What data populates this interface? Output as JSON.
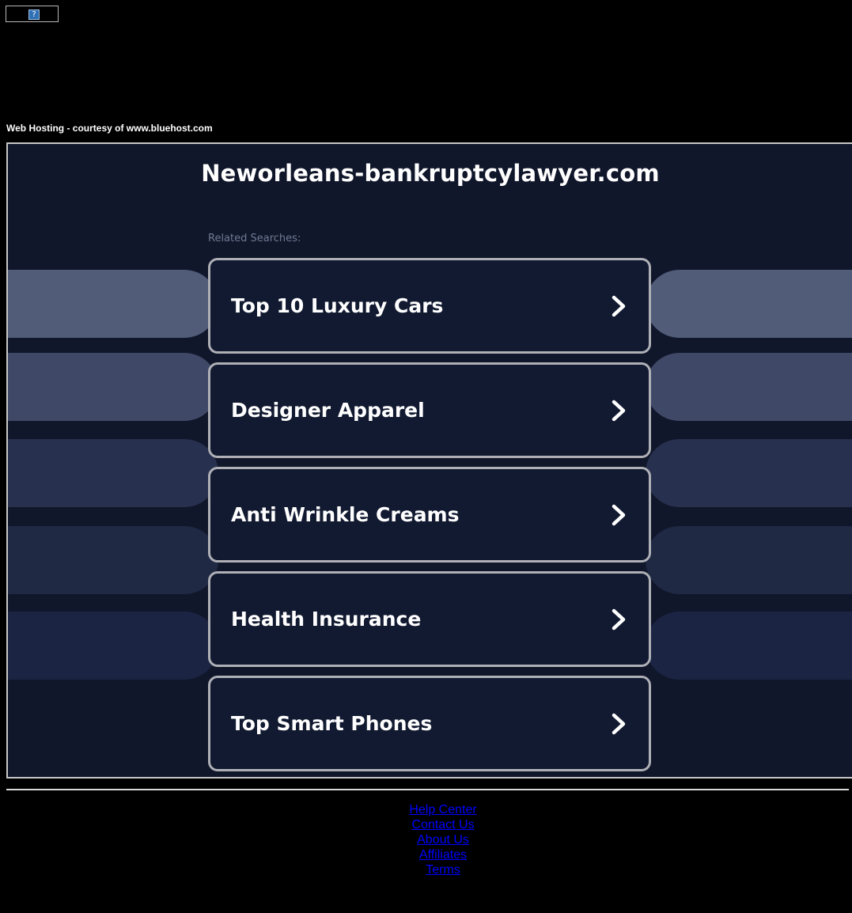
{
  "banner": {
    "broken_image_glyph": "?"
  },
  "hosting_note": "Web Hosting - courtesy of www.bluehost.com",
  "domain_title": "Neworleans-bankruptcylawyer.com",
  "related_label": "Related Searches:",
  "searches": [
    {
      "label": "Top 10 Luxury Cars"
    },
    {
      "label": "Designer Apparel"
    },
    {
      "label": "Anti Wrinkle Creams"
    },
    {
      "label": "Health Insurance"
    },
    {
      "label": "Top Smart Phones"
    }
  ],
  "side_pill_colors": [
    "#515c79",
    "#3f4967",
    "#27304e",
    "#1f2944",
    "#1b2443"
  ],
  "icons": {
    "card_arrow": "chevron-right-icon"
  },
  "footer": {
    "links": [
      "Help Center",
      "Contact Us",
      "About Us",
      "Affiliates",
      "Terms"
    ]
  },
  "colors": {
    "page_bg": "#000000",
    "panel_bg": "#11172b",
    "card_border": "#aeb0b6",
    "link": "#0000ff"
  }
}
